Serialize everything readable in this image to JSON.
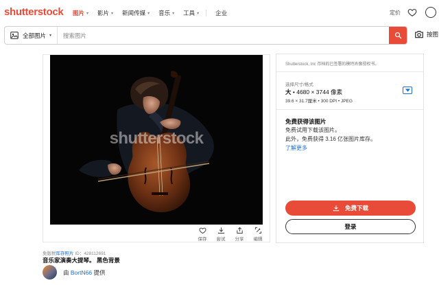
{
  "brand": {
    "logo": "shutterstock",
    "accent": "#e84b37",
    "link_color": "#1a6fd6"
  },
  "nav": {
    "items": [
      {
        "label": "图片",
        "active": true,
        "has_menu": true
      },
      {
        "label": "影片",
        "active": false,
        "has_menu": true
      },
      {
        "label": "新闻传媒",
        "active": false,
        "has_menu": true
      },
      {
        "label": "音乐",
        "active": false,
        "has_menu": true
      },
      {
        "label": "工具",
        "active": false,
        "has_menu": true
      },
      {
        "label": "企业",
        "active": false,
        "has_menu": false
      }
    ],
    "pricing": "定价"
  },
  "search": {
    "category": "全部图片",
    "placeholder": "搜索图片",
    "value": "",
    "image_search_label": "按图"
  },
  "image": {
    "watermark": "shutterstock",
    "actions": [
      {
        "label": "保存",
        "icon": "heart-icon"
      },
      {
        "label": "尝试",
        "icon": "download-icon"
      },
      {
        "label": "分享",
        "icon": "share-icon"
      },
      {
        "label": "编辑",
        "icon": "edit-icon"
      }
    ],
    "meta_prefix": "免版税",
    "meta_link": "库存照片",
    "meta_id_label": "ID：",
    "meta_id": "428112691",
    "title": "音乐家演奏大提琴。 黑色背景",
    "contributor_prefix": "由",
    "contributor_name": "BortN66",
    "contributor_suffix": "提供"
  },
  "panel": {
    "license_text": "Shutterstock, Inc 存档的已签署的模特肖像授权书。",
    "size_label": "选择尺寸/格式",
    "size_name": "大",
    "size_dims": " • 4680 × 3744 像素",
    "size_detail": "39.6 × 31.7厘米 • 300 DPI • JPEG",
    "free_heading": "免费获得该图片",
    "free_line1": "免费试用下载该图片。",
    "free_line2": "此外，免费获得 3.16 亿张图片库存。",
    "learn_more": "了解更多",
    "download_label": "免费下载",
    "login_label": "登录"
  }
}
